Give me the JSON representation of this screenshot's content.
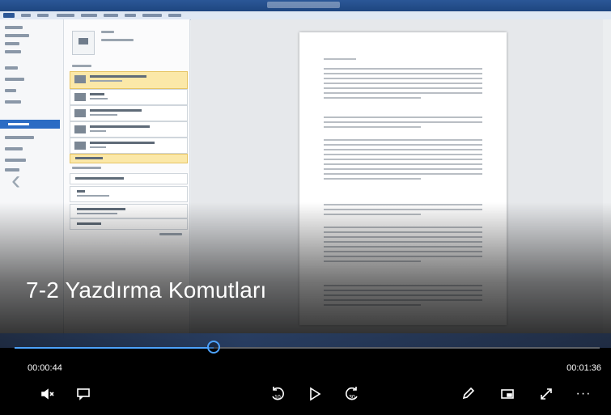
{
  "video": {
    "caption": "7-2 Yazdırma Komutları",
    "elapsed": "00:00:44",
    "duration": "00:01:36",
    "progress": 0.34
  },
  "controls": {
    "icons": [
      "mute-icon",
      "subtitles-icon",
      "rewind-10-icon",
      "play-icon",
      "forward-30-icon",
      "pen-icon",
      "miniview-icon",
      "fullscreen-icon",
      "more-icon"
    ],
    "rewind_label": "10",
    "forward_label": "30",
    "more_label": "···"
  },
  "nav": {
    "prev_glyph": "‹"
  },
  "colors": {
    "accent": "#4da3ff",
    "selected_printer": "#fbe8a8"
  }
}
